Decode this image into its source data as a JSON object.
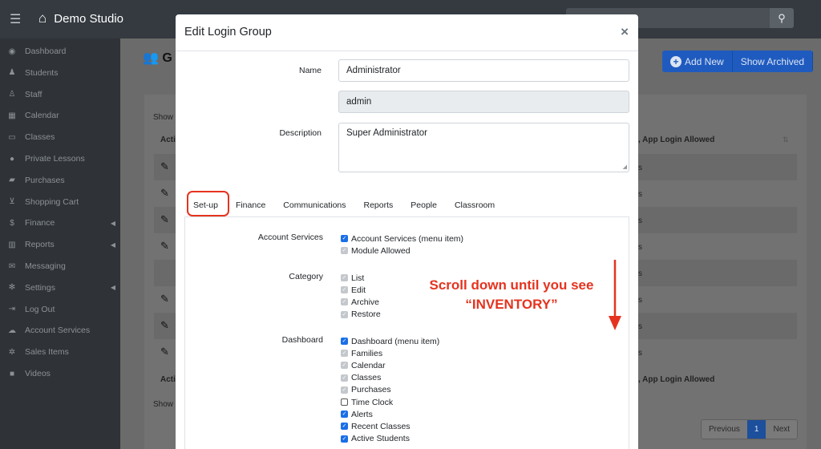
{
  "topbar": {
    "menu_icon": "hamburger-icon",
    "home_icon": "home-icon",
    "brand": "Demo Studio",
    "search_icon": "search-icon"
  },
  "sidebar": {
    "items": [
      {
        "label": "Dashboard",
        "icon": "dashboard-icon",
        "glyph": "◉",
        "arrow": false
      },
      {
        "label": "Students",
        "icon": "student-icon",
        "glyph": "♟",
        "arrow": false
      },
      {
        "label": "Staff",
        "icon": "staff-icon",
        "glyph": "♙",
        "arrow": false
      },
      {
        "label": "Calendar",
        "icon": "calendar-icon",
        "glyph": "▦",
        "arrow": false
      },
      {
        "label": "Classes",
        "icon": "classes-icon",
        "glyph": "▭",
        "arrow": false
      },
      {
        "label": "Private Lessons",
        "icon": "private-lessons-icon",
        "glyph": "●",
        "arrow": false
      },
      {
        "label": "Purchases",
        "icon": "bag-icon",
        "glyph": "▰",
        "arrow": false
      },
      {
        "label": "Shopping Cart",
        "icon": "cart-icon",
        "glyph": "⊻",
        "arrow": false
      },
      {
        "label": "Finance",
        "icon": "dollar-icon",
        "glyph": "$",
        "arrow": true
      },
      {
        "label": "Reports",
        "icon": "chart-icon",
        "glyph": "▥",
        "arrow": true
      },
      {
        "label": "Messaging",
        "icon": "envelope-icon",
        "glyph": "✉",
        "arrow": false
      },
      {
        "label": "Settings",
        "icon": "gear-icon",
        "glyph": "✻",
        "arrow": true
      },
      {
        "label": "Log Out",
        "icon": "logout-icon",
        "glyph": "⇥",
        "arrow": false
      },
      {
        "label": "Account Services",
        "icon": "cloud-icon",
        "glyph": "☁",
        "arrow": false
      },
      {
        "label": "Sales Items",
        "icon": "tags-icon",
        "glyph": "✲",
        "arrow": false
      },
      {
        "label": "Videos",
        "icon": "video-icon",
        "glyph": "■",
        "arrow": false
      }
    ]
  },
  "page": {
    "title_partial": "G",
    "add_new": "Add New",
    "show_archived": "Show Archived",
    "show_top": "Show",
    "show_bottom": "Show",
    "col_action": "Acti",
    "col_action_footer": "Acti",
    "col_login": ", App Login Allowed",
    "col_login_footer": ", App Login Allowed",
    "row_fragment": "s",
    "pager": {
      "previous": "Previous",
      "current": "1",
      "next": "Next"
    }
  },
  "modal": {
    "title": "Edit Login Group",
    "close": "×",
    "name_label": "Name",
    "name_value": "Administrator",
    "code_value": "admin",
    "description_label": "Description",
    "description_value": "Super Administrator",
    "tabs": [
      "Set-up",
      "Finance",
      "Communications",
      "Reports",
      "People",
      "Classroom"
    ],
    "active_tab": "Set-up",
    "sections": [
      {
        "label": "Account Services",
        "items": [
          {
            "label": "Account Services (menu item)",
            "state": "checked"
          },
          {
            "label": "Module Allowed",
            "state": "disabled"
          }
        ]
      },
      {
        "label": "Category",
        "items": [
          {
            "label": "List",
            "state": "disabled"
          },
          {
            "label": "Edit",
            "state": "disabled"
          },
          {
            "label": "Archive",
            "state": "disabled"
          },
          {
            "label": "Restore",
            "state": "disabled"
          }
        ]
      },
      {
        "label": "Dashboard",
        "items": [
          {
            "label": "Dashboard (menu item)",
            "state": "checked"
          },
          {
            "label": "Families",
            "state": "disabled"
          },
          {
            "label": "Calendar",
            "state": "disabled"
          },
          {
            "label": "Classes",
            "state": "disabled"
          },
          {
            "label": "Purchases",
            "state": "disabled"
          },
          {
            "label": "Time Clock",
            "state": "empty"
          },
          {
            "label": "Alerts",
            "state": "checked"
          },
          {
            "label": "Recent Classes",
            "state": "checked"
          },
          {
            "label": "Active Students",
            "state": "checked"
          }
        ]
      }
    ]
  },
  "annotation": {
    "line1": "Scroll down until you see",
    "line2": "“INVENTORY”",
    "color": "#e5331f"
  }
}
